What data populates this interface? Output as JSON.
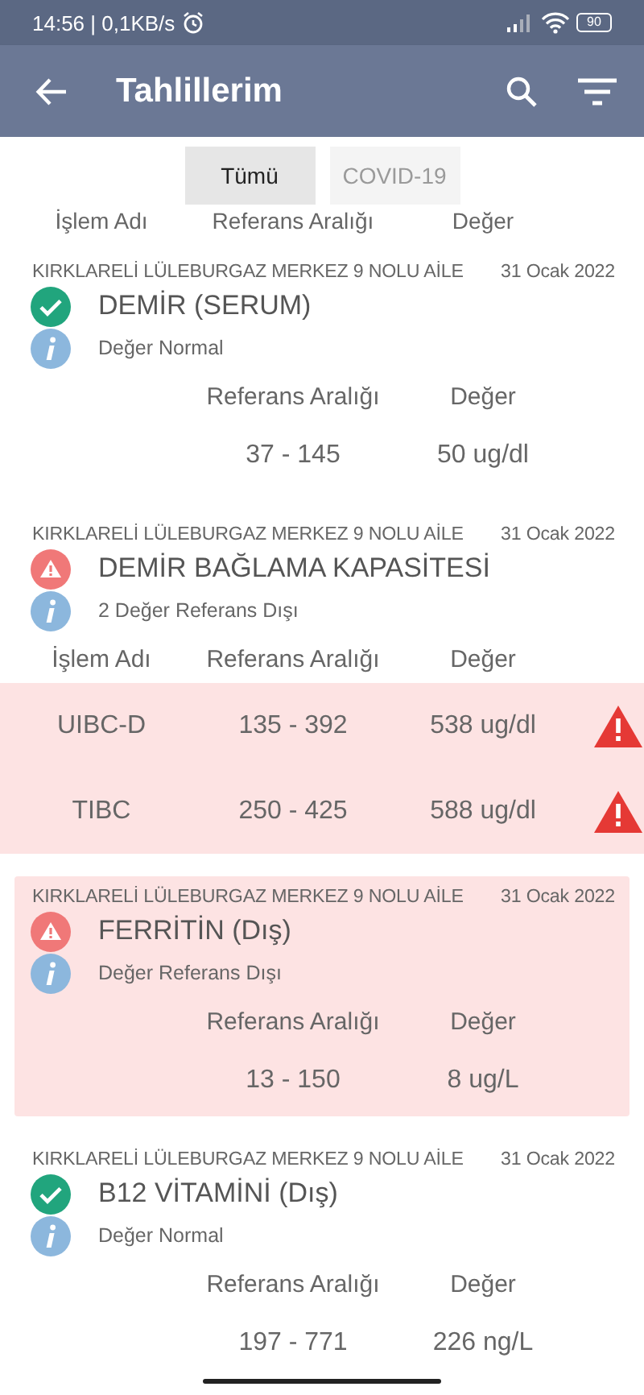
{
  "status_bar": {
    "time": "14:56 | 0,1KB/s",
    "battery": "90"
  },
  "app_bar": {
    "title": "Tahlillerim"
  },
  "tabs": [
    {
      "label": "Tümü",
      "selected": true
    },
    {
      "label": "COVID-19",
      "selected": false
    }
  ],
  "cut_header": [
    "İşlem Adı",
    "Referans Aralığı",
    "Değer"
  ],
  "tests": [
    {
      "institution": "KIRKLARELİ LÜLEBURGAZ MERKEZ 9 NOLU AİLE",
      "date": "31 Ocak 2022",
      "name": "DEMİR (SERUM)",
      "kind": "normal",
      "message": "Değer Normal",
      "highlighted": false,
      "columns": [
        "",
        "Referans Aralığı",
        "Değer"
      ],
      "rows": [
        {
          "name": "",
          "range": "37 - 145",
          "value": "50 ug/dl",
          "flagged": false
        }
      ]
    },
    {
      "institution": "KIRKLARELİ LÜLEBURGAZ MERKEZ 9 NOLU AİLE",
      "date": "31 Ocak 2022",
      "name": "DEMİR BAĞLAMA KAPASİTESİ",
      "kind": "abnormal",
      "message": "2 Değer Referans Dışı",
      "highlighted": false,
      "columns": [
        "İşlem Adı",
        "Referans Aralığı",
        "Değer"
      ],
      "rows": [
        {
          "name": "UIBC-D",
          "range": "135 - 392",
          "value": "538 ug/dl",
          "flagged": true
        },
        {
          "name": "TIBC",
          "range": "250 - 425",
          "value": "588 ug/dl",
          "flagged": true
        }
      ]
    },
    {
      "institution": "KIRKLARELİ LÜLEBURGAZ MERKEZ 9 NOLU AİLE",
      "date": "31 Ocak 2022",
      "name": "FERRİTİN (Dış)",
      "kind": "abnormal",
      "message": "Değer Referans Dışı",
      "highlighted": true,
      "columns": [
        "",
        "Referans Aralığı",
        "Değer"
      ],
      "rows": [
        {
          "name": "",
          "range": "13 - 150",
          "value": "8 ug/L",
          "flagged": false
        }
      ]
    },
    {
      "institution": "KIRKLARELİ LÜLEBURGAZ MERKEZ 9 NOLU AİLE",
      "date": "31 Ocak 2022",
      "name": "B12 VİTAMİNİ (Dış)",
      "kind": "normal",
      "message": "Değer Normal",
      "highlighted": false,
      "columns": [
        "",
        "Referans Aralığı",
        "Değer"
      ],
      "rows": [
        {
          "name": "",
          "range": "197 - 771",
          "value": "226 ng/L",
          "flagged": false
        }
      ]
    }
  ]
}
